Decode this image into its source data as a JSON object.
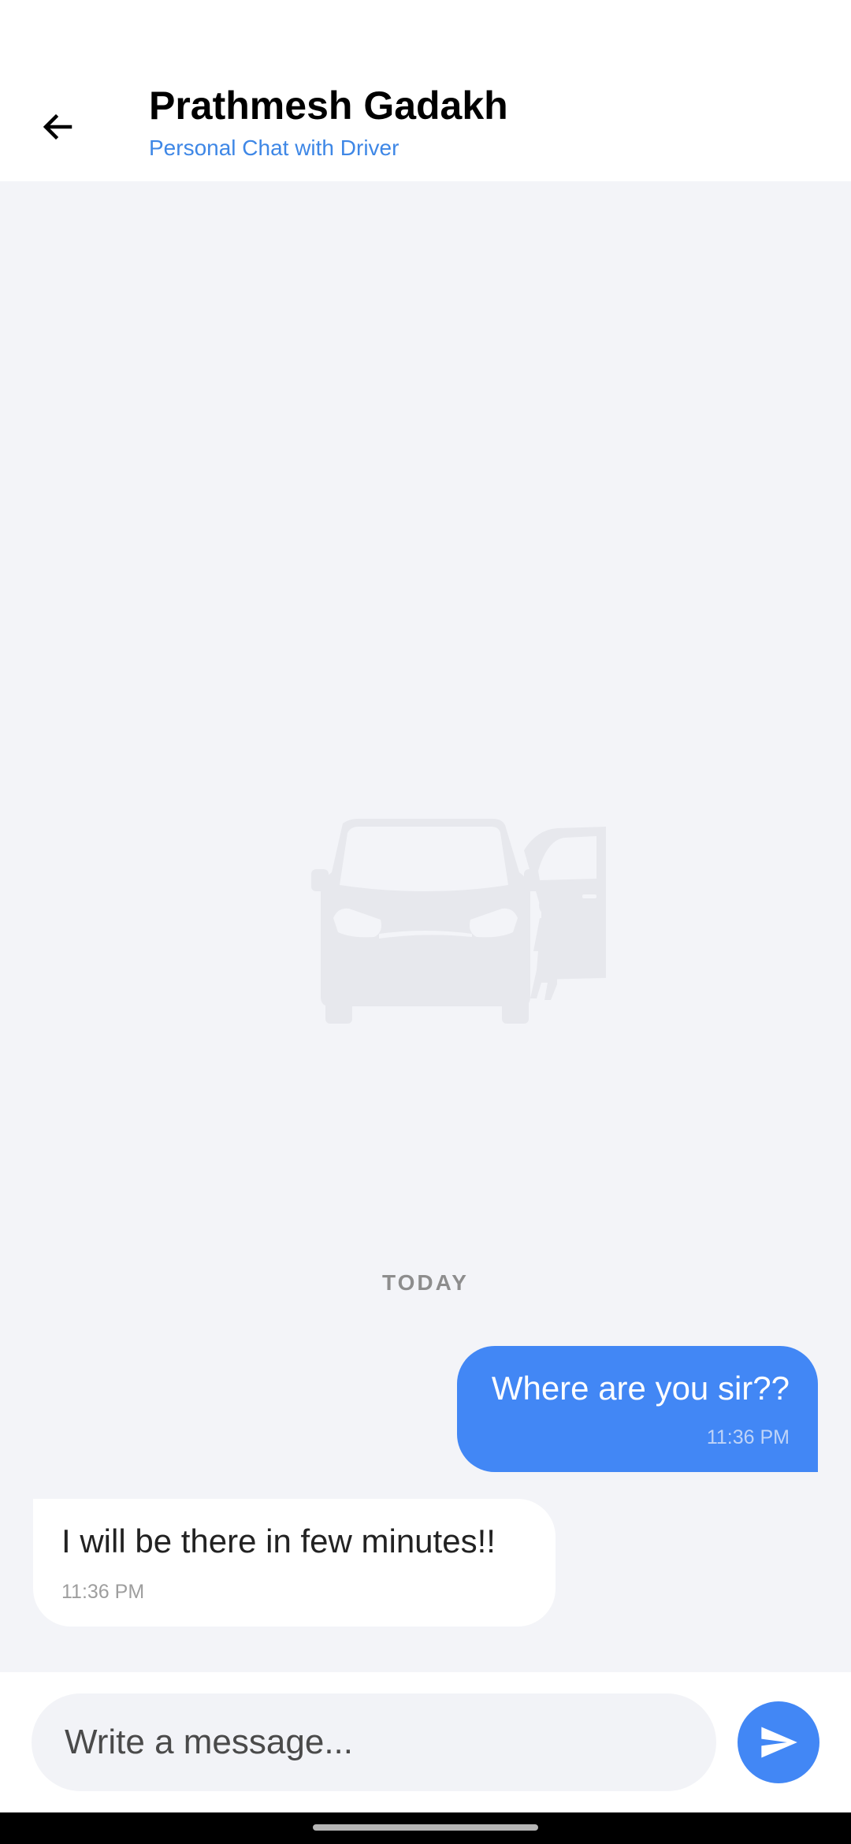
{
  "header": {
    "title": "Prathmesh Gadakh",
    "subtitle": "Personal Chat with Driver"
  },
  "chat": {
    "date_divider": "TODAY",
    "messages": [
      {
        "direction": "sent",
        "text": "Where are you sir??",
        "time": "11:36 PM"
      },
      {
        "direction": "received",
        "text": "I will be there in few minutes!!",
        "time": "11:36 PM"
      }
    ]
  },
  "composer": {
    "placeholder": "Write a message..."
  },
  "colors": {
    "accent": "#4287f5",
    "subtitle": "#3e87e6",
    "chat_background": "#f3f4f8"
  },
  "icons": {
    "back": "arrow-left-icon",
    "send": "send-icon",
    "watermark": "van-illustration"
  }
}
